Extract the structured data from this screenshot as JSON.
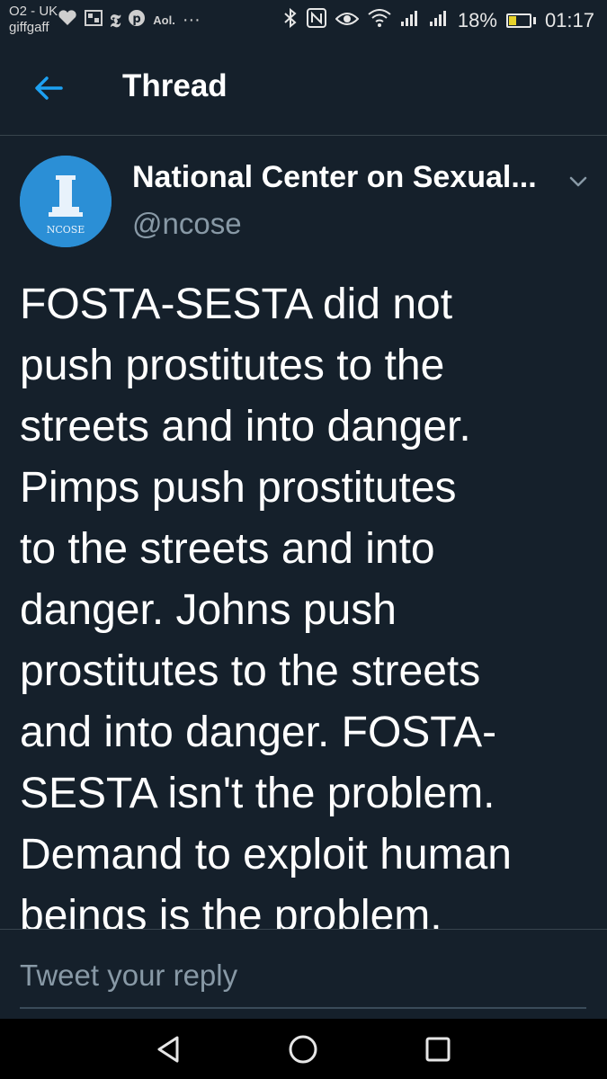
{
  "status_bar": {
    "carrier_line1": "O2 - UK",
    "carrier_line2": "giffgaff",
    "notification_icons": [
      "giffgaff-heart-icon",
      "photos-icon",
      "nyt-icon",
      "pinterest-icon"
    ],
    "aol_label": "Aol.",
    "more_label": "···",
    "battery_percent": "18%",
    "time": "01:17"
  },
  "header": {
    "title": "Thread"
  },
  "tweet": {
    "author_name": "National Center on Sexual...",
    "handle": "@ncose",
    "avatar_label": "NCOSE",
    "text": "FOSTA-SESTA did not\npush prostitutes to the\nstreets and into danger.\nPimps push prostitutes\nto the streets and into\ndanger. Johns push\nprostitutes to the streets\nand into danger. FOSTA-\nSESTA isn't the problem.\nDemand to exploit human\nbeings is the problem."
  },
  "reply": {
    "placeholder": "Tweet your reply"
  },
  "colors": {
    "background": "#15202b",
    "accent": "#1da1f2",
    "secondary_text": "#8899a6",
    "divider": "#38444d"
  }
}
